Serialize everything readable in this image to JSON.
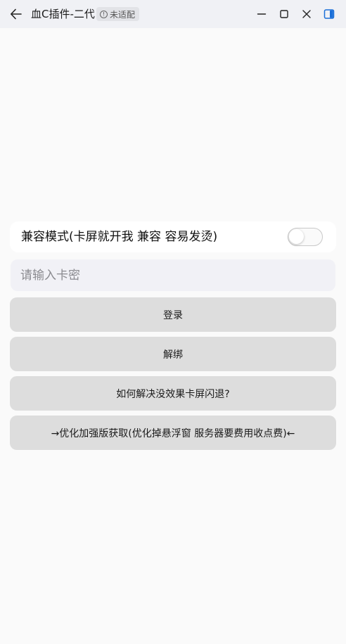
{
  "titlebar": {
    "title": "血C插件-二代",
    "badge_icon": "info-icon",
    "badge_label": "未适配",
    "back_icon": "arrow-left-icon",
    "controls": [
      "minimize-icon",
      "maximize-icon",
      "close-icon",
      "sidebar-panel-icon"
    ],
    "accent_color": "#1a6fd8"
  },
  "compat": {
    "label": "兼容模式(卡屏就开我 兼容 容易发烫)",
    "enabled": false
  },
  "key_input": {
    "placeholder": "请输入卡密",
    "value": ""
  },
  "buttons": {
    "login": "登录",
    "unbind": "解绑",
    "howto": "如何解决没效果卡屏闪退?",
    "enhanced": "→优化加强版获取(优化掉悬浮窗 服务器要费用收点费)←"
  }
}
